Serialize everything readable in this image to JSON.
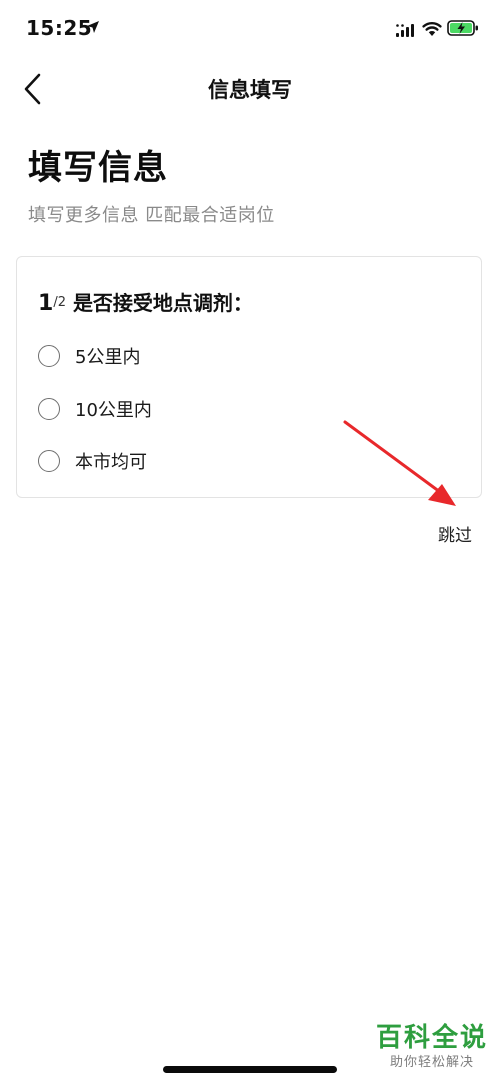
{
  "status_bar": {
    "time": "15:25",
    "icons": [
      "location-arrow-icon",
      "signal-icon",
      "wifi-icon",
      "battery-charging-icon"
    ]
  },
  "nav": {
    "back_icon": "chevron-left-icon",
    "title": "信息填写"
  },
  "header": {
    "title": "填写信息",
    "subtitle": "填写更多信息 匹配最合适岗位"
  },
  "question": {
    "step": "1",
    "total": "/2",
    "text": "是否接受地点调剂：",
    "options": [
      {
        "label": "5公里内",
        "selected": false
      },
      {
        "label": "10公里内",
        "selected": false
      },
      {
        "label": "本市均可",
        "selected": false
      }
    ]
  },
  "skip_label": "跳过",
  "annotation": {
    "arrow_color": "#e8282b"
  },
  "watermark": {
    "main": "百科全说",
    "sub": "助你轻松解决",
    "color": "#2e9e3f"
  }
}
